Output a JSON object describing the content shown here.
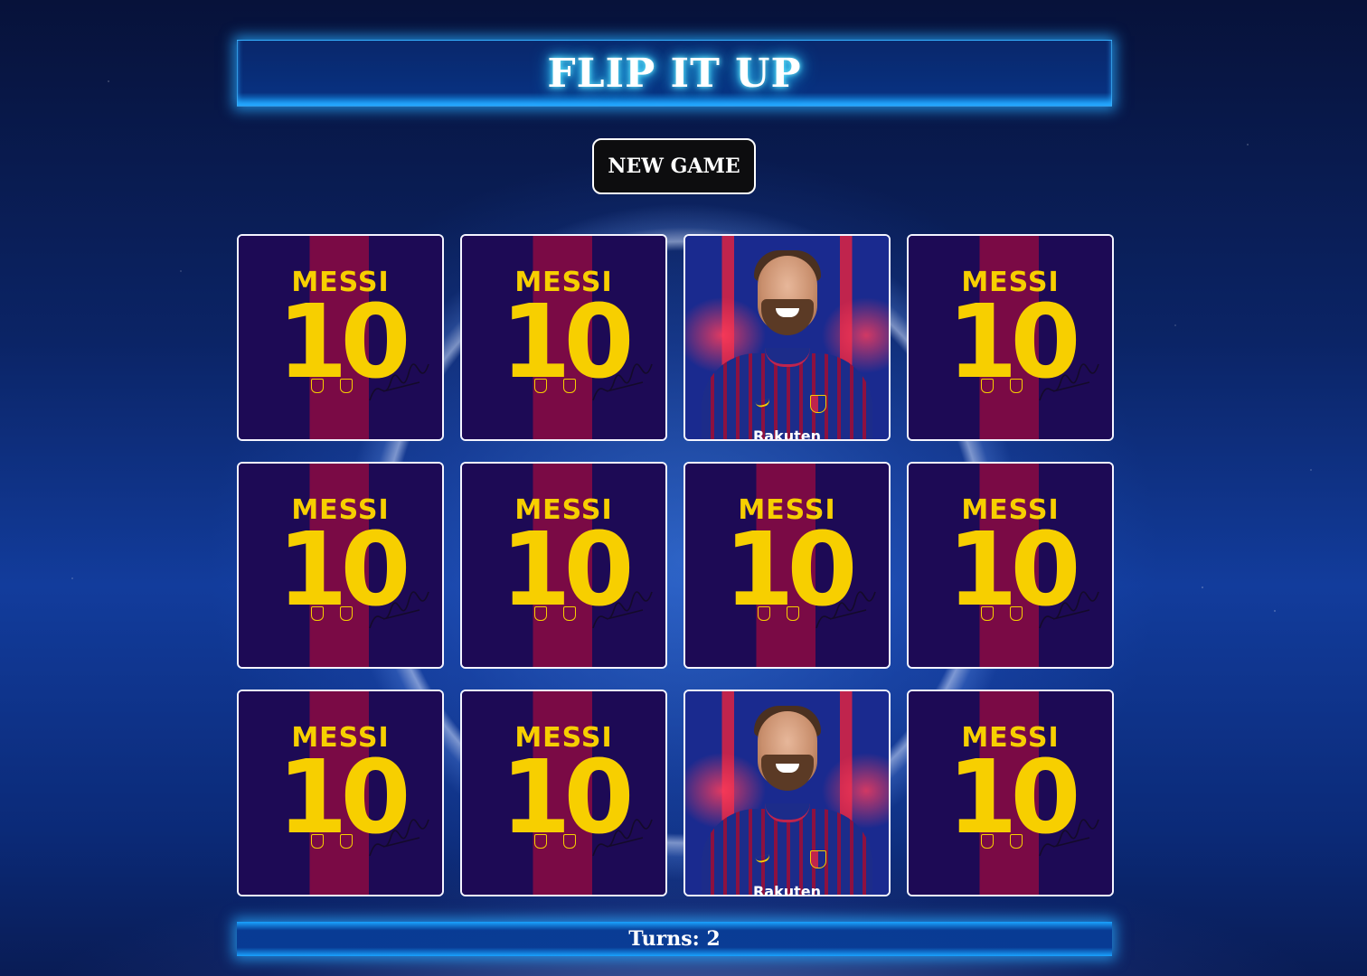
{
  "header": {
    "title": "FLIP IT UP"
  },
  "controls": {
    "new_game_label": "NEW GAME"
  },
  "board": {
    "rows": 3,
    "columns": 4,
    "cards": [
      {
        "state": "face-down",
        "back_name": "MESSI",
        "back_number": "10"
      },
      {
        "state": "face-down",
        "back_name": "MESSI",
        "back_number": "10"
      },
      {
        "state": "face-up",
        "image": "player-portrait",
        "sponsor": "Rakuten"
      },
      {
        "state": "face-down",
        "back_name": "MESSI",
        "back_number": "10"
      },
      {
        "state": "face-down",
        "back_name": "MESSI",
        "back_number": "10"
      },
      {
        "state": "face-down",
        "back_name": "MESSI",
        "back_number": "10"
      },
      {
        "state": "face-down",
        "back_name": "MESSI",
        "back_number": "10"
      },
      {
        "state": "face-down",
        "back_name": "MESSI",
        "back_number": "10"
      },
      {
        "state": "face-down",
        "back_name": "MESSI",
        "back_number": "10"
      },
      {
        "state": "face-down",
        "back_name": "MESSI",
        "back_number": "10"
      },
      {
        "state": "face-up",
        "image": "player-portrait",
        "sponsor": "Rakuten"
      },
      {
        "state": "face-down",
        "back_name": "MESSI",
        "back_number": "10"
      }
    ]
  },
  "status": {
    "turns_label": "Turns: 2"
  },
  "colors": {
    "accent_glow": "#1aa3ff",
    "title_glow": "#39d2ff",
    "card_gold": "#f7cf00",
    "card_navy": "#1d0a55",
    "card_garnet": "#7a0a45"
  }
}
